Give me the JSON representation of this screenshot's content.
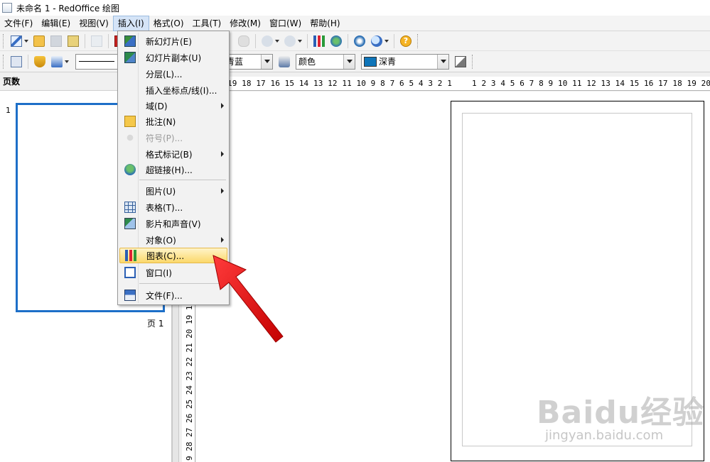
{
  "window": {
    "title": "未命名 1 - RedOffice 绘图"
  },
  "menubar": {
    "items": [
      {
        "label": "文件(F)",
        "active": false
      },
      {
        "label": "编辑(E)",
        "active": false
      },
      {
        "label": "视图(V)",
        "active": false
      },
      {
        "label": "插入(I)",
        "active": true
      },
      {
        "label": "格式(O)",
        "active": false
      },
      {
        "label": "工具(T)",
        "active": false
      },
      {
        "label": "修改(M)",
        "active": false
      },
      {
        "label": "窗口(W)",
        "active": false
      },
      {
        "label": "帮助(H)",
        "active": false
      }
    ]
  },
  "toolbar2": {
    "area_style_value": "青蓝",
    "fill_type_value": "颜色",
    "fill_color_value": "深青",
    "fill_color_hex": "#0f75b9"
  },
  "insert_menu": {
    "items": [
      {
        "label": "新幻灯片(E)",
        "icon": "new-slide-icon",
        "submenu": false,
        "disabled": false
      },
      {
        "label": "幻灯片副本(U)",
        "icon": "duplicate-slide-icon",
        "submenu": false,
        "disabled": false
      },
      {
        "label": "分层(L)...",
        "icon": "",
        "submenu": false,
        "disabled": false
      },
      {
        "label": "插入坐标点/线(I)...",
        "icon": "",
        "submenu": false,
        "disabled": false
      },
      {
        "label": "域(D)",
        "icon": "",
        "submenu": true,
        "disabled": false
      },
      {
        "label": "批注(N)",
        "icon": "comment-icon",
        "submenu": false,
        "disabled": false
      },
      {
        "label": "符号(P)...",
        "icon": "symbol-icon",
        "submenu": false,
        "disabled": true
      },
      {
        "label": "格式标记(B)",
        "icon": "",
        "submenu": true,
        "disabled": false
      },
      {
        "label": "超链接(H)...",
        "icon": "hyperlink-icon",
        "submenu": false,
        "disabled": false
      },
      {
        "label": "图片(U)",
        "icon": "",
        "submenu": true,
        "disabled": false
      },
      {
        "label": "表格(T)...",
        "icon": "table-icon",
        "submenu": false,
        "disabled": false
      },
      {
        "label": "影片和声音(V)",
        "icon": "movie-sound-icon",
        "submenu": false,
        "disabled": false
      },
      {
        "label": "对象(O)",
        "icon": "",
        "submenu": true,
        "disabled": false
      },
      {
        "label": "图表(C)...",
        "icon": "chart-icon",
        "submenu": false,
        "disabled": false,
        "highlighted": true
      },
      {
        "label": "窗口(I)",
        "icon": "frame-icon",
        "submenu": false,
        "disabled": false
      },
      {
        "label": "文件(F)...",
        "icon": "file-icon",
        "submenu": false,
        "disabled": false
      }
    ]
  },
  "pages_panel": {
    "title": "页数",
    "slide_number": "1",
    "caption": "页 1"
  },
  "rulers": {
    "horizontal_left": "19 18 17 16 15 14 13 12 11 10 9 8 7 6 5 4 3 2 1",
    "horizontal_right": "1 2 3 4 5 6 7 8 9 10 11 12 13 14 15 16 17 18 19 20",
    "vertical": "9 28 27 26 25 24 23 22 21 20 19 18 17 1"
  },
  "watermark": {
    "logo": "Baidu经验",
    "sub": "jingyan.baidu.com"
  }
}
